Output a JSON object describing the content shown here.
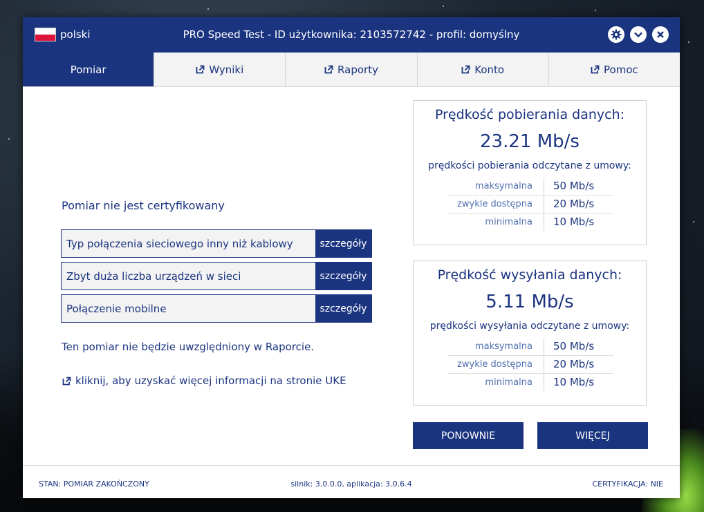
{
  "header": {
    "language": "polski",
    "title": "PRO Speed Test - ID użytkownika: 2103572742 - profil: domyślny",
    "buttons": [
      "gear-icon",
      "chevron-down-icon",
      "close-icon"
    ]
  },
  "tabs": [
    {
      "label": "Pomiar",
      "active": true,
      "icon": ""
    },
    {
      "label": "Wyniki",
      "active": false,
      "icon": "external-link-icon"
    },
    {
      "label": "Raporty",
      "active": false,
      "icon": "external-link-icon"
    },
    {
      "label": "Konto",
      "active": false,
      "icon": "external-link-icon"
    },
    {
      "label": "Pomoc",
      "active": false,
      "icon": "external-link-icon"
    }
  ],
  "left": {
    "message": "Pomiar nie jest certyfikowany",
    "details_label": "szczegóły",
    "issues": [
      "Typ połączenia sieciowego inny niż kablowy",
      "Zbyt duża liczba urządzeń w sieci",
      "Połączenie mobilne"
    ],
    "note": "Ten pomiar nie będzie uwzględniony w Raporcie.",
    "link": "kliknij, aby uzyskać więcej informacji na stronie UKE"
  },
  "download": {
    "title": "Prędkość pobierania danych:",
    "speed": "23.21 Mb/s",
    "subtitle": "prędkości pobierania odczytane z umowy:",
    "rows": [
      {
        "label": "maksymalna",
        "value": "50 Mb/s"
      },
      {
        "label": "zwykle dostępna",
        "value": "20 Mb/s"
      },
      {
        "label": "minimalna",
        "value": "10 Mb/s"
      }
    ]
  },
  "upload": {
    "title": "Prędkość wysyłania danych:",
    "speed": "5.11 Mb/s",
    "subtitle": "prędkości wysyłania odczytane z umowy:",
    "rows": [
      {
        "label": "maksymalna",
        "value": "50 Mb/s"
      },
      {
        "label": "zwykle dostępna",
        "value": "20 Mb/s"
      },
      {
        "label": "minimalna",
        "value": "10 Mb/s"
      }
    ]
  },
  "actions": {
    "retry": "PONOWNIE",
    "more": "WIĘCEJ"
  },
  "status": {
    "state": "STAN: POMIAR ZAKOŃCZONY",
    "version": "silnik: 3.0.0.0, aplikacja: 3.0.6.4",
    "certification": "CERTYFIKACJA: NIE"
  },
  "colors": {
    "primary": "#1b3480",
    "tab_bg": "#f3f3f3",
    "link_light": "#4f6fb0"
  }
}
